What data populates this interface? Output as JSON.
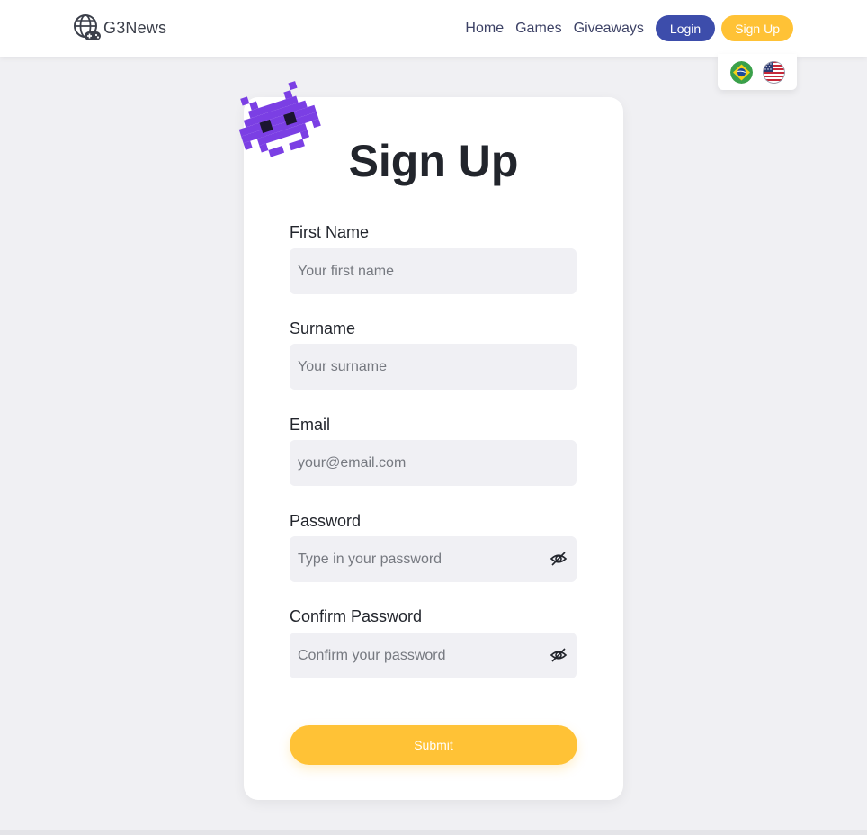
{
  "header": {
    "brand": "G3News",
    "nav": [
      {
        "label": "Home"
      },
      {
        "label": "Games"
      },
      {
        "label": "Giveaways"
      }
    ],
    "login_label": "Login",
    "signup_label": "Sign Up"
  },
  "languages": [
    {
      "icon": "brazil-flag-icon"
    },
    {
      "icon": "usa-flag-icon"
    }
  ],
  "form": {
    "title": "Sign Up",
    "first_name": {
      "label": "First Name",
      "placeholder": "Your first name"
    },
    "surname": {
      "label": "Surname",
      "placeholder": "Your surname"
    },
    "email": {
      "label": "Email",
      "placeholder": "your@email.com"
    },
    "password": {
      "label": "Password",
      "placeholder": "Type in your password"
    },
    "confirm_password": {
      "label": "Confirm Password",
      "placeholder": "Confirm your password"
    },
    "submit_label": "Submit"
  },
  "colors": {
    "primary": "#3d4dab",
    "accent": "#ffc236",
    "mascot": "#7b3fe4",
    "background": "#f0f0f3"
  }
}
